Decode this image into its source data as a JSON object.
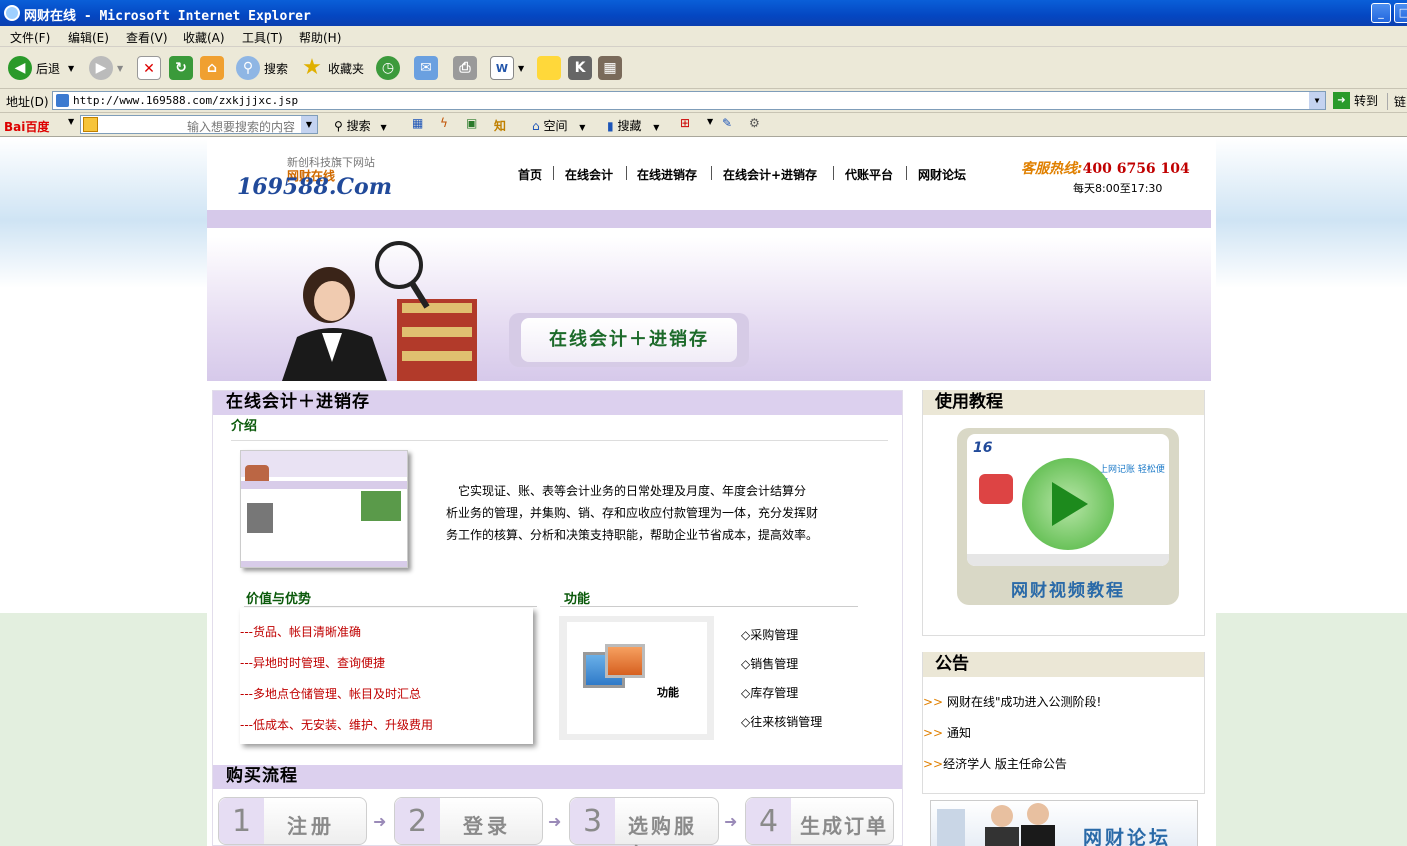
{
  "window": {
    "title": "网财在线 - Microsoft Internet Explorer"
  },
  "menu": [
    "文件(F)",
    "编辑(E)",
    "查看(V)",
    "收藏(A)",
    "工具(T)",
    "帮助(H)"
  ],
  "toolbar": {
    "back": "后退",
    "search": "搜索",
    "favorites": "收藏夹"
  },
  "address": {
    "label": "地址(D)",
    "url": "http://www.169588.com/zxkjjjxc.jsp",
    "go": "转到",
    "links": "链"
  },
  "baidu": {
    "logo": "Bai百度",
    "placeholder": "输入想要搜索的内容",
    "search": "搜索",
    "space": "空间",
    "collect": "搜藏",
    "know": "知"
  },
  "header": {
    "logo_tag": "新创科技旗下网站",
    "logo_brand": "网财在线",
    "logo_text": "169588.Com",
    "nav": [
      "首页",
      "在线会计",
      "在线进销存",
      "在线会计+进销存",
      "代账平台",
      "网财论坛"
    ],
    "hotline_label": "客服热线:",
    "hotline_num": "400 6756 104",
    "hours": "每天8:00至17:30"
  },
  "banner": {
    "caption": "在线会计＋进销存"
  },
  "main": {
    "title": "在线会计＋进销存",
    "intro_title": "介绍",
    "intro_lines": [
      "它实现证、账、表等会计业务的日常处理及月度、年度会计结算分",
      "析业务的管理，并集购、销、存和应收应付款管理为一体，充分发挥财",
      "务工作的核算、分析和决策支持职能，帮助企业节省成本，提高效率。"
    ],
    "value_title": "价值与优势",
    "values": [
      "---货品、帐目清晰准确",
      "---异地时时管理、查询便捷",
      "---多地点仓储管理、帐目及时汇总",
      "---低成本、无安装、维护、升级费用"
    ],
    "func_title": "功能",
    "func_img_label": "功能",
    "functions": [
      "◇采购管理",
      "◇销售管理",
      "◇库存管理",
      "◇往来核销管理"
    ],
    "buy_title": "购买流程",
    "steps": [
      {
        "num": "1",
        "label": "注册"
      },
      {
        "num": "2",
        "label": "登录"
      },
      {
        "num": "3",
        "label": "选购服务"
      },
      {
        "num": "4",
        "label": "生成订单"
      }
    ]
  },
  "sidebar": {
    "tutorial_title": "使用教程",
    "video_label": "网财视频教程",
    "video_slogan": "上网记账 轻松便捷",
    "notice_title": "公告",
    "notices": [
      "网财在线\"成功进入公测阶段!",
      "通知",
      "经济学人  版主任命公告"
    ],
    "notice_marker": ">>",
    "forum_label": "网财论坛"
  }
}
